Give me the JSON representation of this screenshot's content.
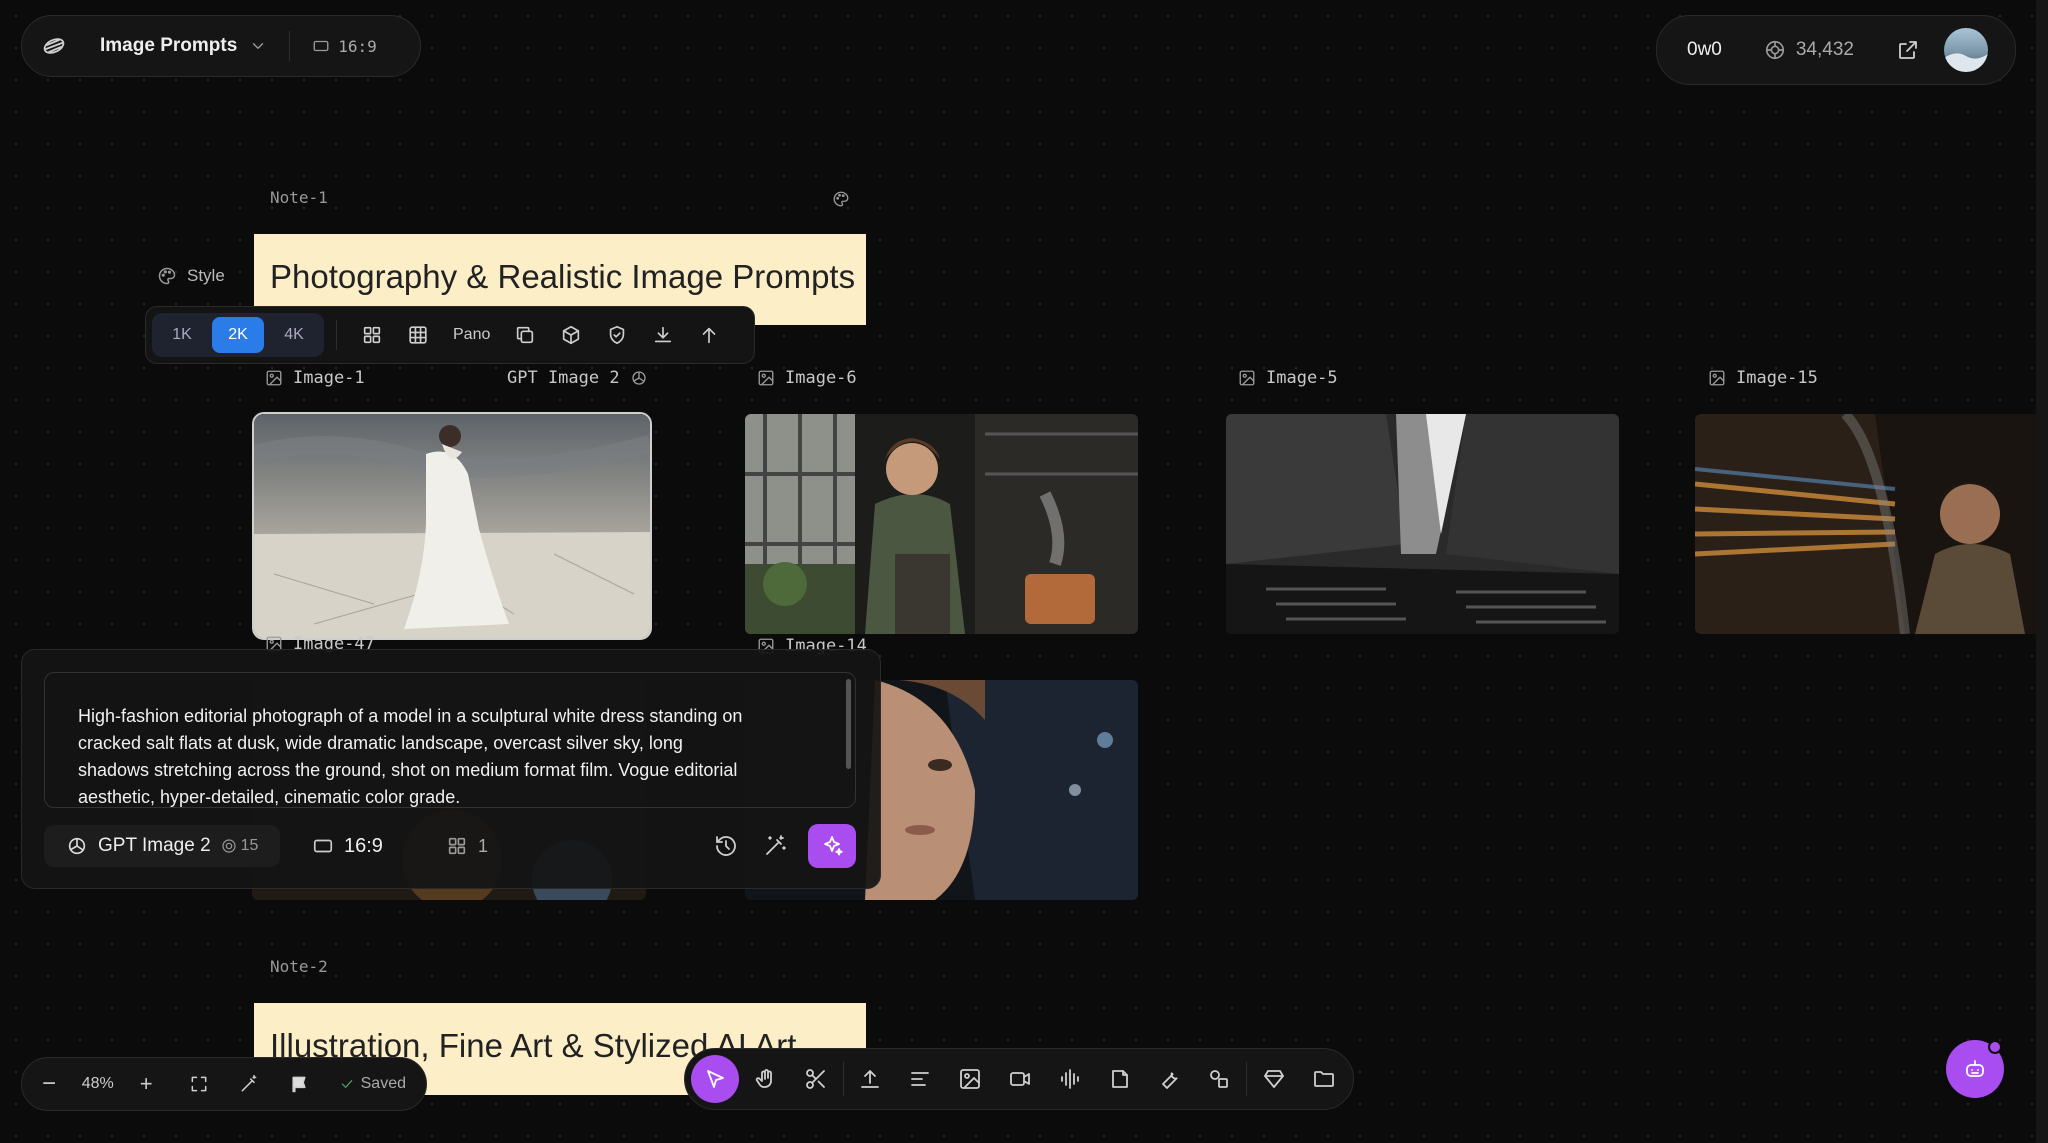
{
  "app": {
    "project_title": "Image Prompts",
    "aspect": "16:9",
    "username": "0w0",
    "credits": "34,432"
  },
  "notes": [
    {
      "header": "Note-1",
      "title": "Photography & Realistic Image Prompts"
    },
    {
      "header": "Note-2",
      "title": "Illustration, Fine Art & Stylized AI Art"
    }
  ],
  "style_label": "Style",
  "image_toolbar": {
    "res_options": [
      "1K",
      "2K",
      "4K"
    ],
    "res_selected": "2K",
    "pano_label": "Pano"
  },
  "images": [
    {
      "label": "Image-1",
      "model": "GPT Image 2"
    },
    {
      "label": "Image-6"
    },
    {
      "label": "Image-5"
    },
    {
      "label": "Image-15"
    },
    {
      "label": "Image-47"
    },
    {
      "label": "Image-14"
    }
  ],
  "prompt_panel": {
    "text": "High-fashion editorial photograph of a model in a sculptural white dress standing on cracked salt flats at dusk, wide dramatic landscape, overcast silver sky, long shadows stretching across the ground, shot on medium format film. Vogue editorial aesthetic, hyper-detailed, cinematic color grade.",
    "model": "GPT Image 2",
    "cost": "15",
    "aspect": "16:9",
    "count": "1"
  },
  "bottom_left": {
    "zoom": "48%",
    "saved": "Saved"
  },
  "colors": {
    "accent_purple": "#a94cf0",
    "accent_blue": "#2a7de9",
    "note_bg": "#fcefc8"
  }
}
